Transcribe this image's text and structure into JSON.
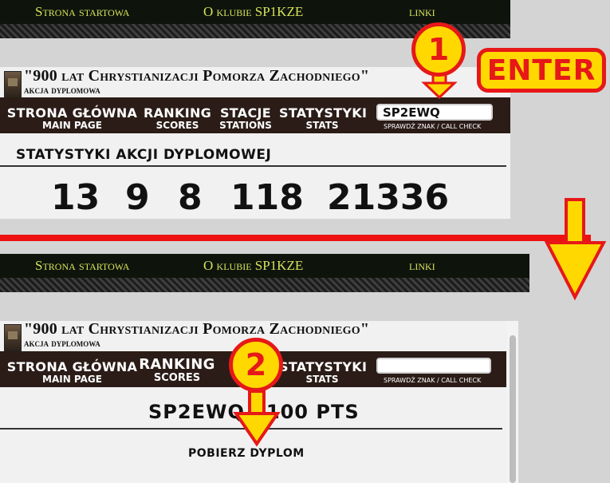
{
  "site_nav": {
    "home": "Strona startowa",
    "about": "O klubie SP1KZE",
    "links": "linki"
  },
  "header": {
    "title": "\"900 lat Chrystianizacji Pomorza Zachodniego\"",
    "subtitle": "akcja dyplomowa"
  },
  "menu": {
    "items_top": [
      {
        "label": "STRONA GŁÓWNA",
        "sub": "MAIN PAGE"
      },
      {
        "label": "RANKING",
        "sub": "SCORES"
      },
      {
        "label": "STACJE",
        "sub": "STATIONS"
      },
      {
        "label": "STATYSTYKI",
        "sub": "STATS"
      }
    ],
    "items_bottom": [
      {
        "label": "STRONA GŁÓWNA",
        "sub": "MAIN PAGE"
      },
      {
        "label": "RANKING",
        "sub": "SCORES"
      },
      {
        "label": "STATYSTYKI",
        "sub": "STATS"
      }
    ],
    "call_value": "SP2EWQ",
    "call_hint": "SPRAWDŹ ZNAK / CALL CHECK"
  },
  "stats_section": {
    "heading": "STATYSTYKI AKCJI DYPLOMOWEJ",
    "numbers": [
      "13",
      "9",
      "8",
      "118",
      "21336"
    ]
  },
  "result_section": {
    "result": "SP2EWQ 3100 PTS",
    "download": "POBIERZ DYPLOM"
  },
  "annotations": {
    "step1": "1",
    "step2": "2",
    "enter": "ENTER",
    "accent_yellow": "#ffd800",
    "accent_red": "#e61818"
  }
}
